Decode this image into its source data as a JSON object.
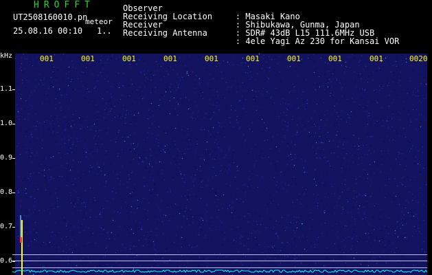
{
  "header": {
    "title": "HROFFT",
    "filename": "UT2508160010.pn",
    "tag": "meteor",
    "datetime": "25.08.16 00:10",
    "counter": "1.."
  },
  "meta": [
    {
      "label": "Observer",
      "sep": ":",
      "value": "Masaki Kano"
    },
    {
      "label": "Receiving Location",
      "sep": ":",
      "value": "Shibukawa, Gunma, Japan"
    },
    {
      "label": "Receiver",
      "sep": ":",
      "value": "SDR# 43dB L15 111.6MHz USB"
    },
    {
      "label": "Receiving Antenna",
      "sep": ":",
      "value": "4ele Yagi Az 230 for Kansai VOR"
    }
  ],
  "spectrogram": {
    "yunit": "kHz",
    "yticks": [
      "1.1",
      "1.0",
      "0.9",
      "0.8",
      "0.7",
      "0.6"
    ],
    "xticks": [
      "001",
      "001",
      "001",
      "001",
      "001",
      "001",
      "001",
      "001",
      "001",
      "0020"
    ]
  },
  "colors": {
    "background": "#0f0f5a",
    "title": "#2fd32f",
    "tick_label": "#ffff00",
    "signal_baseline": "#00ffff",
    "carrier": "#ffff00",
    "meteor_head": "#ff3030"
  },
  "icons": {
    "meteor_echo": "meteor-echo-mark",
    "carrier_line": "carrier-line"
  }
}
